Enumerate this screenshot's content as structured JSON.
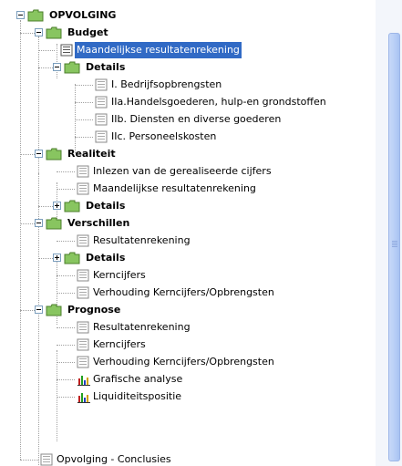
{
  "tree": {
    "root": {
      "label": "OPVOLGING",
      "state": "expanded"
    },
    "groups": [
      {
        "label": "Budget",
        "state": "expanded",
        "items": [
          {
            "label": "Maandelijkse resultatenrekening",
            "selected": true
          },
          {
            "label": "Details",
            "folder": true,
            "state": "expanded",
            "items": [
              {
                "label": "I. Bedrijfsopbrengsten"
              },
              {
                "label": "IIa.Handelsgoederen, hulp-en grondstoffen"
              },
              {
                "label": "IIb. Diensten en diverse goederen"
              },
              {
                "label": "IIc. Personeelskosten"
              }
            ]
          }
        ]
      },
      {
        "label": "Realiteit",
        "state": "expanded",
        "items": [
          {
            "label": "Inlezen van de gerealiseerde cijfers"
          },
          {
            "label": "Maandelijkse resultatenrekening"
          },
          {
            "label": "Details",
            "folder": true,
            "state": "collapsed"
          }
        ]
      },
      {
        "label": "Verschillen",
        "state": "expanded",
        "items": [
          {
            "label": "Resultatenrekening"
          },
          {
            "label": "Details",
            "folder": true,
            "state": "collapsed"
          },
          {
            "label": "Kerncijfers"
          },
          {
            "label": "Verhouding Kerncijfers/Opbrengsten"
          }
        ]
      },
      {
        "label": "Prognose",
        "state": "expanded",
        "items": [
          {
            "label": "Resultatenrekening"
          },
          {
            "label": "Kerncijfers"
          },
          {
            "label": "Verhouding Kerncijfers/Opbrengsten"
          },
          {
            "label": "Grafische analyse",
            "icon": "bar-chart-icon"
          },
          {
            "label": "Liquiditeitspositie",
            "icon": "bar-chart-icon"
          }
        ]
      }
    ],
    "footer_item": {
      "label": "Opvolging - Conclusies"
    }
  },
  "colors": {
    "selection": "#316ac5",
    "folder_fill": "#88c560",
    "scrollbar_thumb": "#b6cdf6"
  }
}
